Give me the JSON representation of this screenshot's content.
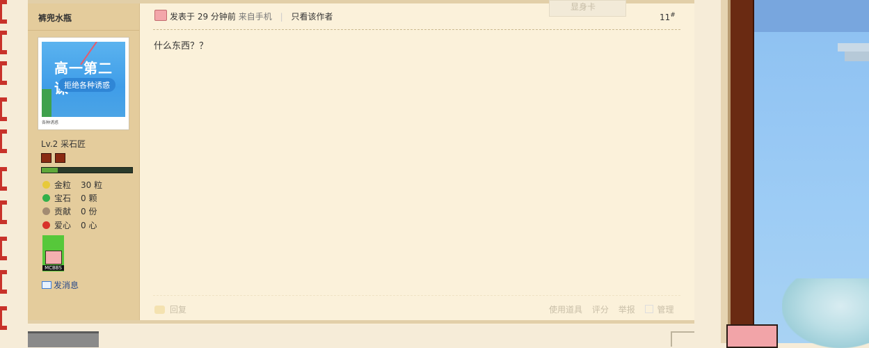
{
  "author": {
    "name": "裤兜水瓶"
  },
  "avatar": {
    "headline": "高一第二课",
    "subline": "拒绝各种诱惑",
    "caption": "各种诱惑"
  },
  "profile": {
    "level": "Lv.2 采石匠",
    "progress": 0.18,
    "stats": [
      {
        "label": "金粒",
        "value": "30 粒",
        "icon": "gold-nugget-icon",
        "color": "#e7c93a"
      },
      {
        "label": "宝石",
        "value": "0 颗",
        "icon": "emerald-icon",
        "color": "#32b04a"
      },
      {
        "label": "贡献",
        "value": "0 份",
        "icon": "contribution-icon",
        "color": "#a28b72"
      },
      {
        "label": "爱心",
        "value": "0 心",
        "icon": "apple-heart-icon",
        "color": "#d8322a"
      }
    ],
    "medal_text": "MCBBS",
    "send_message": "发消息"
  },
  "post": {
    "posted_label": "发表于 29 分钟前",
    "source": "来自手机",
    "separator": "|",
    "only_author": "只看该作者",
    "floor": "11",
    "floor_mark": "#",
    "content": "什么东西？？"
  },
  "footer": {
    "reply": "回复",
    "use_tool": "使用道具",
    "rate": "评分",
    "report": "举报",
    "manage": "管理"
  },
  "floating": {
    "show_card": "显身卡"
  }
}
